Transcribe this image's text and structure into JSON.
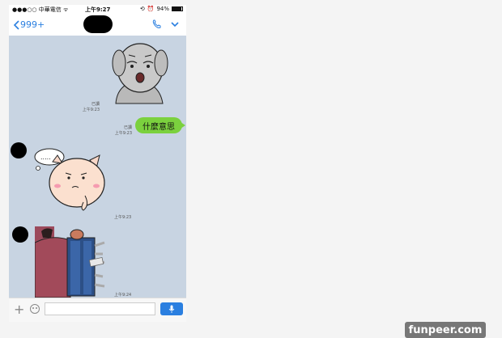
{
  "status_bar": {
    "carrier": "●●●○○ 中華電信 ᯤ",
    "time": "上午9:27",
    "battery": "94%"
  },
  "nav": {
    "back_label": "999+"
  },
  "messages": [
    {
      "type": "sticker",
      "side": "right",
      "read": "已讀",
      "time": "上午9:23"
    },
    {
      "type": "text",
      "side": "right",
      "read": "已讀",
      "time": "上午9:23",
      "text": "什麼意思"
    },
    {
      "type": "sticker",
      "side": "left",
      "time": "上午9:23"
    },
    {
      "type": "sticker",
      "side": "left",
      "time": "上午9:24"
    }
  ],
  "input": {
    "placeholder": ""
  },
  "watermark": "funpeer.com",
  "colors": {
    "accent": "#2a7fe0",
    "bubble": "#7bd13e",
    "chat_bg": "#c8d4e2"
  }
}
